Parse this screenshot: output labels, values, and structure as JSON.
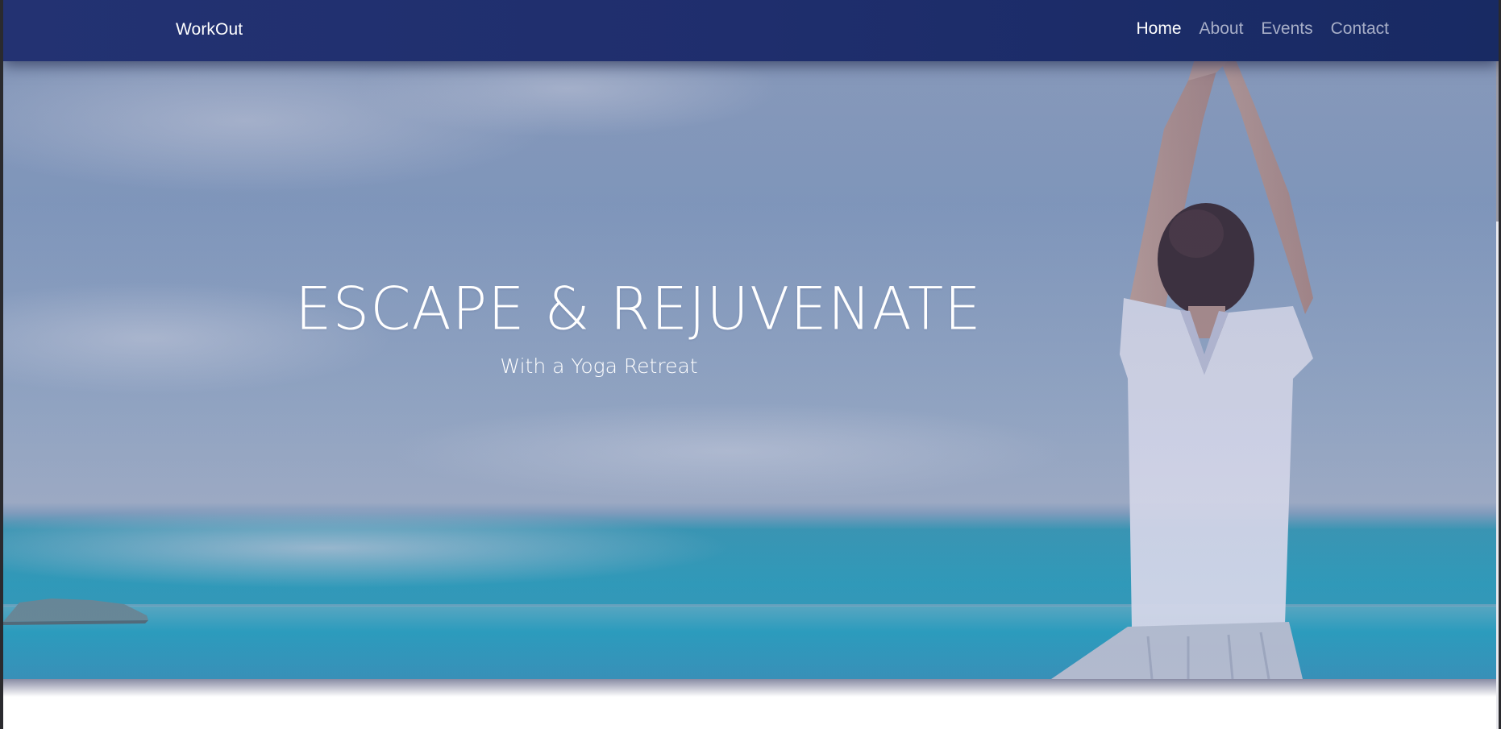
{
  "navbar": {
    "brand": "WorkOut",
    "links": [
      {
        "label": "Home",
        "active": true
      },
      {
        "label": "About",
        "active": false
      },
      {
        "label": "Events",
        "active": false
      },
      {
        "label": "Contact",
        "active": false
      }
    ]
  },
  "hero": {
    "title": "ESCAPE & REJUVENATE",
    "subtitle": "With a Yoga Retreat",
    "background_image": "yoga-by-the-sea-photo"
  },
  "colors": {
    "navbar": "#1f2e6d",
    "nav_inactive": "#a8afc8",
    "nav_active": "#ffffff",
    "hero_text": "#ffffff"
  }
}
